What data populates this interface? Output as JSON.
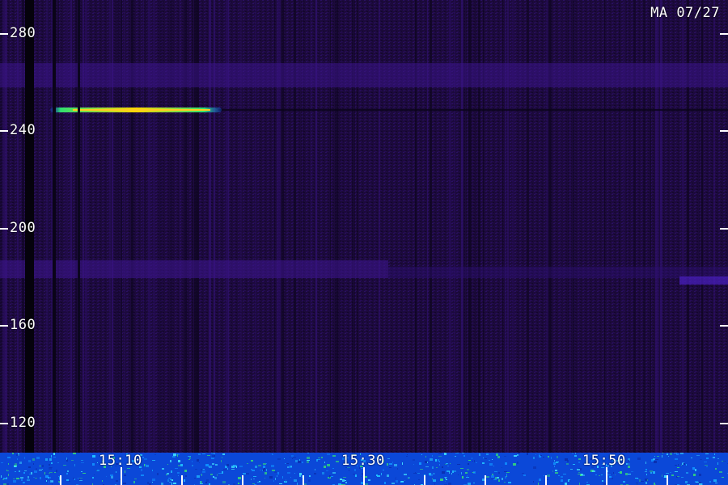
{
  "header": {
    "station_label": "MA 07/27"
  },
  "axes": {
    "y_ticks": [
      "280",
      "240",
      "200",
      "160",
      "120"
    ],
    "x_ticks": [
      "15:10",
      "15:30",
      "15:50"
    ]
  },
  "colors": {
    "background": "#1a0838",
    "signal_hot": "#ffd800",
    "signal_warm": "#30e070",
    "signal_cool": "#1060ff",
    "noise_floor": "#0b48d8"
  }
}
